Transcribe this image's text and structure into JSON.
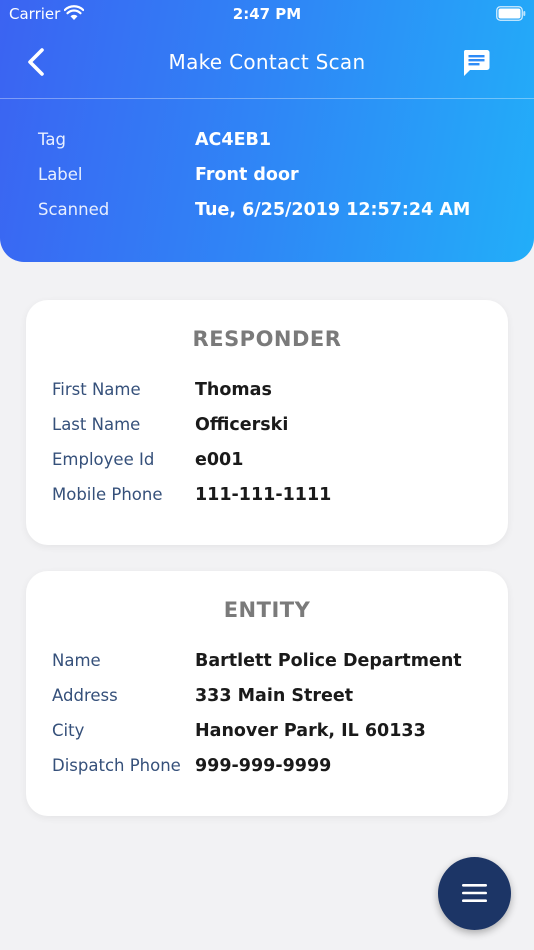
{
  "status_bar": {
    "carrier": "Carrier",
    "time": "2:47 PM"
  },
  "nav": {
    "title": "Make Contact Scan",
    "back_icon": "chevron-left-icon",
    "chat_icon": "message-icon"
  },
  "scan_info": [
    {
      "label": "Tag",
      "value": "AC4EB1"
    },
    {
      "label": "Label",
      "value": "Front door"
    },
    {
      "label": "Scanned",
      "value": "Tue, 6/25/2019 12:57:24 AM"
    }
  ],
  "responder": {
    "title": "RESPONDER",
    "fields": [
      {
        "label": "First Name",
        "value": "Thomas"
      },
      {
        "label": "Last Name",
        "value": "Officerski"
      },
      {
        "label": "Employee Id",
        "value": "e001"
      },
      {
        "label": "Mobile Phone",
        "value": "111-111-1111"
      }
    ]
  },
  "entity": {
    "title": "ENTITY",
    "fields": [
      {
        "label": "Name",
        "value": "Bartlett Police Department"
      },
      {
        "label": "Address",
        "value": "333 Main Street"
      },
      {
        "label": "City",
        "value": "Hanover Park, IL 60133"
      },
      {
        "label": "Dispatch Phone",
        "value": "999-999-9999"
      }
    ]
  },
  "fab": {
    "icon": "menu-icon"
  },
  "colors": {
    "header_gradient_start": "#3b63f2",
    "header_gradient_end": "#22aef9",
    "fab_background": "#1c3566",
    "field_label": "#35507a",
    "card_title": "#7a7a7a"
  }
}
